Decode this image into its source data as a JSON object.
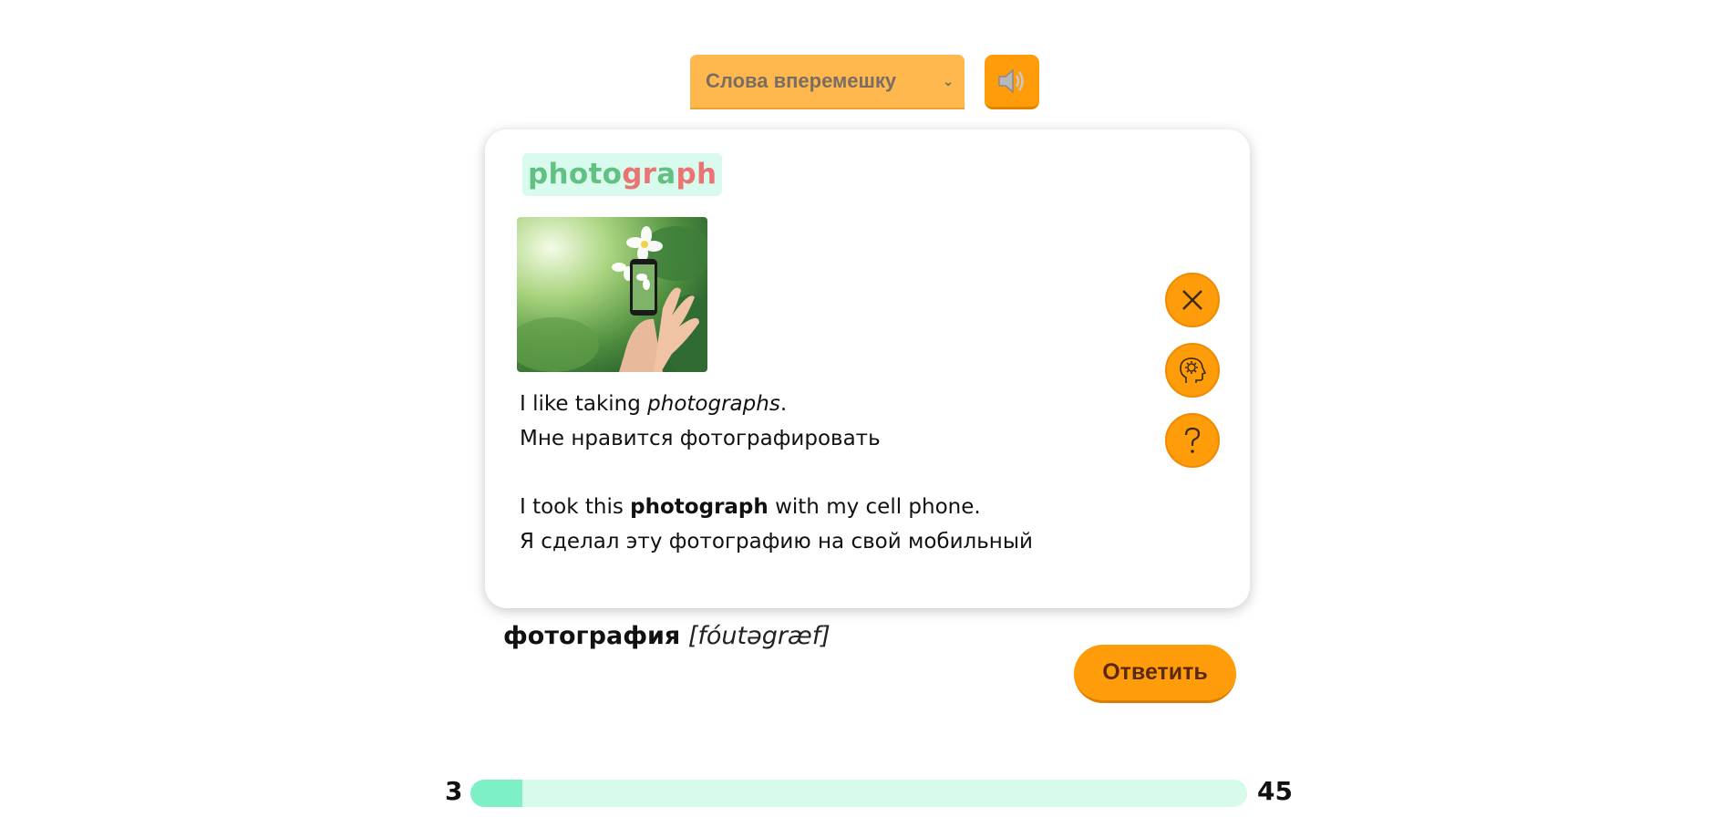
{
  "mode_select": {
    "selected": "Слова вперемешку"
  },
  "card": {
    "word_parts": [
      {
        "text": "photo",
        "status": "correct"
      },
      {
        "text": "gr",
        "status": "wrong"
      },
      {
        "text": "a",
        "status": "correct"
      },
      {
        "text": "ph",
        "status": "wrong"
      }
    ],
    "image_alt": "hand taking photograph of flowers with phone",
    "examples": [
      {
        "en_before": "I like taking ",
        "en_highlight": "photographs",
        "en_after": ".",
        "highlight_style": "italic",
        "ru": "Мне нравится фотографировать"
      },
      {
        "en_before": "I took this ",
        "en_highlight": "photograph",
        "en_after": " with my cell phone.",
        "highlight_style": "bold",
        "ru": "Я сделал эту фотографию на свой мобильный"
      }
    ],
    "side_buttons": [
      {
        "icon": "close-icon"
      },
      {
        "icon": "brain-gear-icon"
      },
      {
        "icon": "question-icon"
      }
    ]
  },
  "answer": {
    "translation": "фотография",
    "transcription": "[fóutəgræf]"
  },
  "reply_button": {
    "label": "Ответить"
  },
  "progress": {
    "current": "3",
    "total": "45",
    "fraction": 0.067
  },
  "colors": {
    "accent": "#ff9c0a",
    "correct": "#63c083",
    "wrong": "#ea7474",
    "progress_fill": "#7df0c5",
    "progress_track": "#d6fbea"
  }
}
